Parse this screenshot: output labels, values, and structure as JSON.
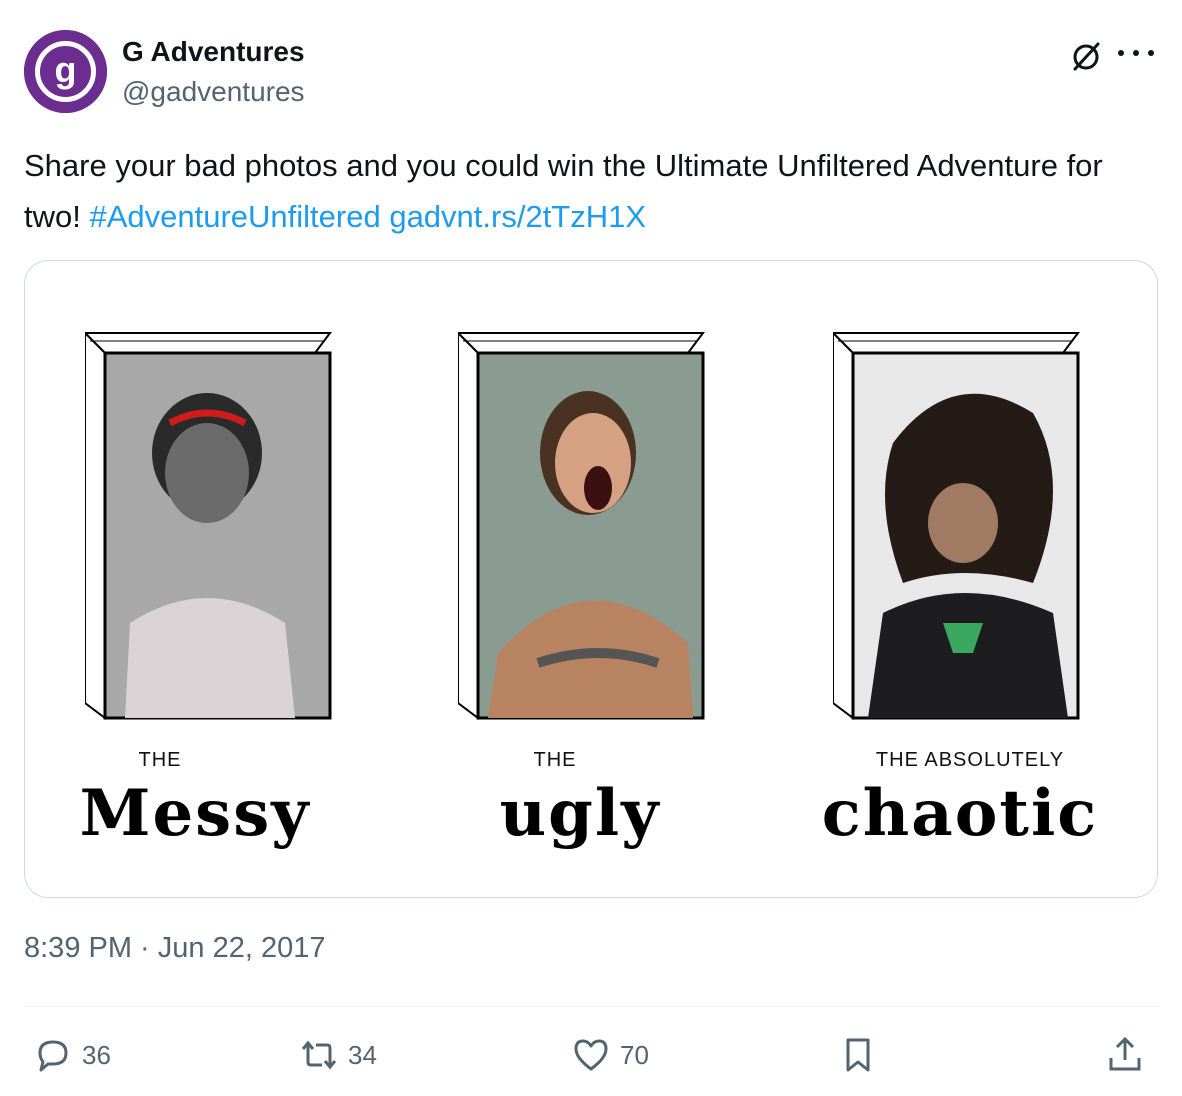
{
  "author": {
    "name": "G Adventures",
    "handle": "@gadventures",
    "avatar_letter": "g",
    "avatar_color": "#6b2d8f"
  },
  "tweet": {
    "text_main": "Share your bad photos and you could win the Ultimate Unfiltered Adventure for two! ",
    "hashtag": "#AdventureUnfiltered",
    "link": "gadvnt.rs/2tTzH1X"
  },
  "media": {
    "panels": [
      {
        "label_small": "THE",
        "label_big": "Messy"
      },
      {
        "label_small": "THE",
        "label_big": "ugly"
      },
      {
        "label_small": "THE ABSOLUTELY",
        "label_big": "chaotic"
      }
    ]
  },
  "timestamp": "8:39 PM · Jun 22, 2017",
  "actions": {
    "replies": "36",
    "retweets": "34",
    "likes": "70"
  },
  "colors": {
    "link": "#1d9bf0",
    "secondary_text": "#536471",
    "border": "#cfd9de"
  }
}
